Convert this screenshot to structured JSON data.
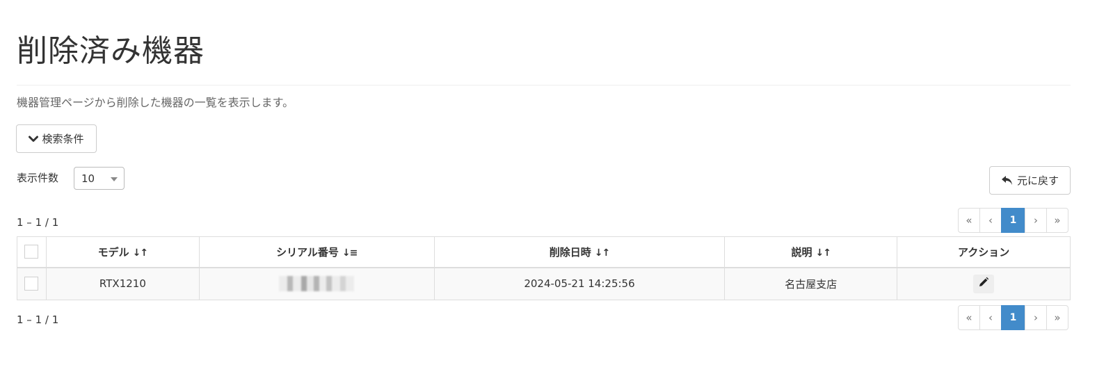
{
  "header": {
    "title": "削除済み機器",
    "description": "機器管理ページから削除した機器の一覧を表示します。"
  },
  "search": {
    "toggle_label": "検索条件",
    "toggle_icon": "chevron-down-icon"
  },
  "page_size": {
    "label": "表示件数",
    "selected": "10"
  },
  "back_button": {
    "label": "元に戻す",
    "icon": "undo-icon"
  },
  "pagination": {
    "range_text": "1 – 1 / 1",
    "first": "«",
    "prev": "‹",
    "current": "1",
    "next": "›",
    "last": "»"
  },
  "table": {
    "columns": [
      "モデル",
      "シリアル番号",
      "削除日時",
      "説明",
      "アクション"
    ],
    "sort_icons": [
      "↓↑",
      "↓≡",
      "↓↑",
      "↓↑"
    ],
    "rows": [
      {
        "model": "RTX1210",
        "deleted_at": "2024-05-21 14:25:56",
        "description": "名古屋支店",
        "action_icon": "pencil-icon"
      }
    ]
  }
}
